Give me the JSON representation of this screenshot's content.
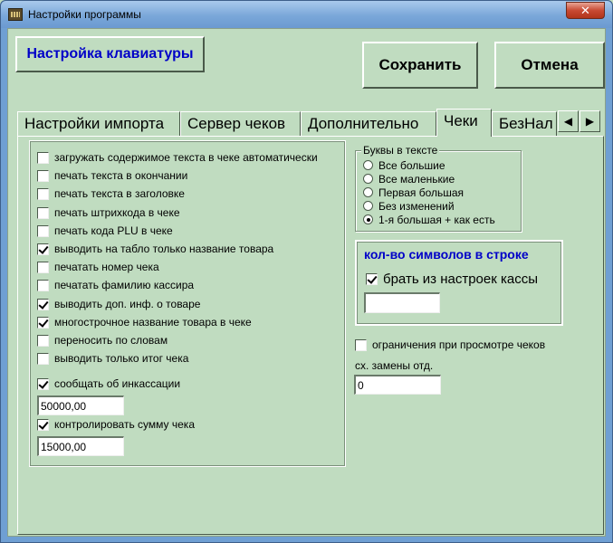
{
  "window": {
    "title": "Настройки программы",
    "close_glyph": "✕"
  },
  "toolbar": {
    "keyboard_button": "Настройка клавиатуры",
    "save_button": "Сохранить",
    "cancel_button": "Отмена"
  },
  "tabs": [
    {
      "label": "Настройки импорта",
      "active": false
    },
    {
      "label": "Сервер чеков",
      "active": false
    },
    {
      "label": "Дополнительно",
      "active": false
    },
    {
      "label": "Чеки",
      "active": true
    },
    {
      "label": "БезНал",
      "active": false
    }
  ],
  "tab_scroll": {
    "left": "◀",
    "right": "▶"
  },
  "receipt_options": [
    {
      "label": "загружать содержимое текста в чеке автоматически",
      "checked": false
    },
    {
      "label": "печать текста в окончании",
      "checked": false
    },
    {
      "label": "печать текста в заголовке",
      "checked": false
    },
    {
      "label": "печать штрихкода в чеке",
      "checked": false
    },
    {
      "label": "печать кода PLU в чеке",
      "checked": false
    },
    {
      "label": "выводить на табло только название товара",
      "checked": true
    },
    {
      "label": "печатать номер чека",
      "checked": false
    },
    {
      "label": "печатать фамилию кассира",
      "checked": false
    },
    {
      "label": "выводить доп. инф. о товаре",
      "checked": true
    },
    {
      "label": "многострочное название товара в чеке",
      "checked": true
    },
    {
      "label": "переносить по словам",
      "checked": false
    },
    {
      "label": "выводить только итог чека",
      "checked": false
    }
  ],
  "collection": {
    "label": "сообщать об инкассации",
    "checked": true,
    "value": "50000,00"
  },
  "receipt_sum": {
    "label": "контролировать сумму чека",
    "checked": true,
    "value": "15000,00"
  },
  "letters": {
    "legend": "Буквы в тексте",
    "options": [
      "Все большие",
      "Все маленькие",
      "Первая большая",
      "Без изменений",
      "1-я большая + как есть"
    ],
    "selected_index": 4
  },
  "chars_per_line": {
    "title": "кол-во символов в строке",
    "from_register_label": "брать из настроек кассы",
    "from_register_checked": true,
    "value": ""
  },
  "view_restrictions": {
    "label": "ограничения при просмотре чеков",
    "checked": false
  },
  "dept_replace": {
    "label": "сх. замены отд.",
    "value": "0"
  }
}
